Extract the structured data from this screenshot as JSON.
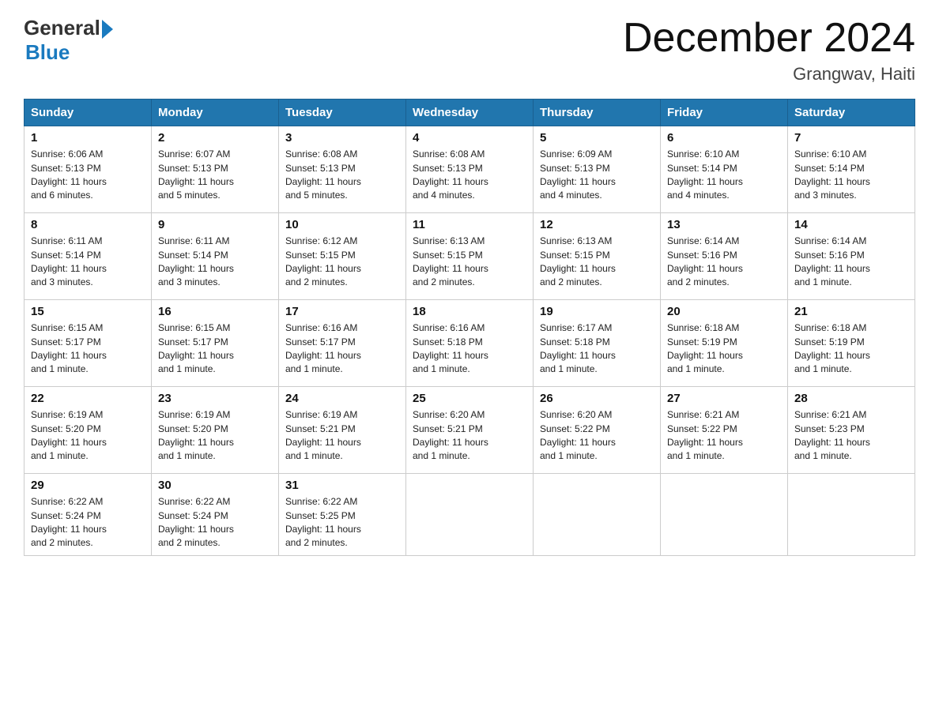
{
  "header": {
    "logo_general": "General",
    "logo_blue": "Blue",
    "month_title": "December 2024",
    "location": "Grangwav, Haiti"
  },
  "days_of_week": [
    "Sunday",
    "Monday",
    "Tuesday",
    "Wednesday",
    "Thursday",
    "Friday",
    "Saturday"
  ],
  "weeks": [
    [
      {
        "day": "1",
        "sunrise": "6:06 AM",
        "sunset": "5:13 PM",
        "daylight": "11 hours and 6 minutes."
      },
      {
        "day": "2",
        "sunrise": "6:07 AM",
        "sunset": "5:13 PM",
        "daylight": "11 hours and 5 minutes."
      },
      {
        "day": "3",
        "sunrise": "6:08 AM",
        "sunset": "5:13 PM",
        "daylight": "11 hours and 5 minutes."
      },
      {
        "day": "4",
        "sunrise": "6:08 AM",
        "sunset": "5:13 PM",
        "daylight": "11 hours and 4 minutes."
      },
      {
        "day": "5",
        "sunrise": "6:09 AM",
        "sunset": "5:13 PM",
        "daylight": "11 hours and 4 minutes."
      },
      {
        "day": "6",
        "sunrise": "6:10 AM",
        "sunset": "5:14 PM",
        "daylight": "11 hours and 4 minutes."
      },
      {
        "day": "7",
        "sunrise": "6:10 AM",
        "sunset": "5:14 PM",
        "daylight": "11 hours and 3 minutes."
      }
    ],
    [
      {
        "day": "8",
        "sunrise": "6:11 AM",
        "sunset": "5:14 PM",
        "daylight": "11 hours and 3 minutes."
      },
      {
        "day": "9",
        "sunrise": "6:11 AM",
        "sunset": "5:14 PM",
        "daylight": "11 hours and 3 minutes."
      },
      {
        "day": "10",
        "sunrise": "6:12 AM",
        "sunset": "5:15 PM",
        "daylight": "11 hours and 2 minutes."
      },
      {
        "day": "11",
        "sunrise": "6:13 AM",
        "sunset": "5:15 PM",
        "daylight": "11 hours and 2 minutes."
      },
      {
        "day": "12",
        "sunrise": "6:13 AM",
        "sunset": "5:15 PM",
        "daylight": "11 hours and 2 minutes."
      },
      {
        "day": "13",
        "sunrise": "6:14 AM",
        "sunset": "5:16 PM",
        "daylight": "11 hours and 2 minutes."
      },
      {
        "day": "14",
        "sunrise": "6:14 AM",
        "sunset": "5:16 PM",
        "daylight": "11 hours and 1 minute."
      }
    ],
    [
      {
        "day": "15",
        "sunrise": "6:15 AM",
        "sunset": "5:17 PM",
        "daylight": "11 hours and 1 minute."
      },
      {
        "day": "16",
        "sunrise": "6:15 AM",
        "sunset": "5:17 PM",
        "daylight": "11 hours and 1 minute."
      },
      {
        "day": "17",
        "sunrise": "6:16 AM",
        "sunset": "5:17 PM",
        "daylight": "11 hours and 1 minute."
      },
      {
        "day": "18",
        "sunrise": "6:16 AM",
        "sunset": "5:18 PM",
        "daylight": "11 hours and 1 minute."
      },
      {
        "day": "19",
        "sunrise": "6:17 AM",
        "sunset": "5:18 PM",
        "daylight": "11 hours and 1 minute."
      },
      {
        "day": "20",
        "sunrise": "6:18 AM",
        "sunset": "5:19 PM",
        "daylight": "11 hours and 1 minute."
      },
      {
        "day": "21",
        "sunrise": "6:18 AM",
        "sunset": "5:19 PM",
        "daylight": "11 hours and 1 minute."
      }
    ],
    [
      {
        "day": "22",
        "sunrise": "6:19 AM",
        "sunset": "5:20 PM",
        "daylight": "11 hours and 1 minute."
      },
      {
        "day": "23",
        "sunrise": "6:19 AM",
        "sunset": "5:20 PM",
        "daylight": "11 hours and 1 minute."
      },
      {
        "day": "24",
        "sunrise": "6:19 AM",
        "sunset": "5:21 PM",
        "daylight": "11 hours and 1 minute."
      },
      {
        "day": "25",
        "sunrise": "6:20 AM",
        "sunset": "5:21 PM",
        "daylight": "11 hours and 1 minute."
      },
      {
        "day": "26",
        "sunrise": "6:20 AM",
        "sunset": "5:22 PM",
        "daylight": "11 hours and 1 minute."
      },
      {
        "day": "27",
        "sunrise": "6:21 AM",
        "sunset": "5:22 PM",
        "daylight": "11 hours and 1 minute."
      },
      {
        "day": "28",
        "sunrise": "6:21 AM",
        "sunset": "5:23 PM",
        "daylight": "11 hours and 1 minute."
      }
    ],
    [
      {
        "day": "29",
        "sunrise": "6:22 AM",
        "sunset": "5:24 PM",
        "daylight": "11 hours and 2 minutes."
      },
      {
        "day": "30",
        "sunrise": "6:22 AM",
        "sunset": "5:24 PM",
        "daylight": "11 hours and 2 minutes."
      },
      {
        "day": "31",
        "sunrise": "6:22 AM",
        "sunset": "5:25 PM",
        "daylight": "11 hours and 2 minutes."
      },
      null,
      null,
      null,
      null
    ]
  ],
  "labels": {
    "sunrise": "Sunrise:",
    "sunset": "Sunset:",
    "daylight": "Daylight:"
  }
}
